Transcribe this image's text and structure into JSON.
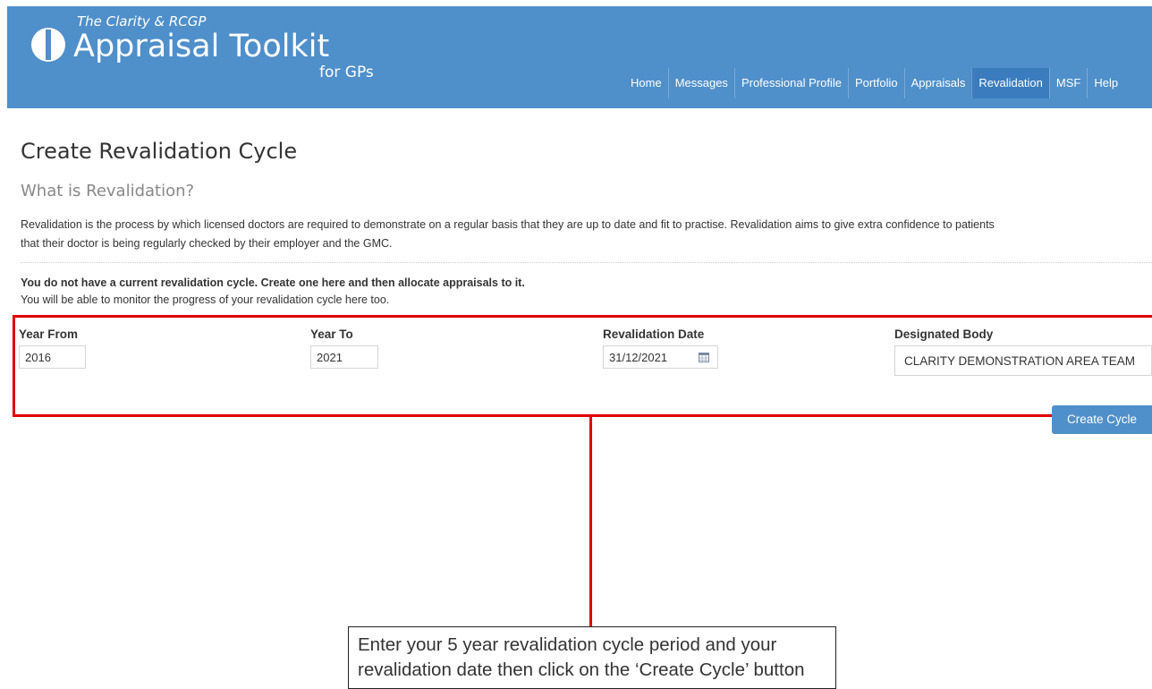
{
  "header": {
    "logo_top": "The Clarity & RCGP",
    "logo_main": "Appraisal Toolkit",
    "logo_sub": "for GPs",
    "nav": [
      {
        "label": "Home",
        "active": false
      },
      {
        "label": "Messages",
        "active": false
      },
      {
        "label": "Professional Profile",
        "active": false
      },
      {
        "label": "Portfolio",
        "active": false
      },
      {
        "label": "Appraisals",
        "active": false
      },
      {
        "label": "Revalidation",
        "active": true
      },
      {
        "label": "MSF",
        "active": false
      },
      {
        "label": "Help",
        "active": false
      }
    ],
    "colors": {
      "bar": "#4f8fca",
      "active": "#3a7cbe"
    }
  },
  "page": {
    "title": "Create Revalidation Cycle",
    "section_title": "What is Revalidation?",
    "intro_line1": "Revalidation is the process by which licensed doctors are required to demonstrate on a regular basis that they are up to date and fit to practise. Revalidation aims to give extra confidence to patients",
    "intro_line2": "that their doctor is being regularly checked by their employer and the GMC.",
    "notice_bold": "You do not have a current revalidation cycle. Create one here and then allocate appraisals to it.",
    "notice": "You will be able to monitor the progress of your revalidation cycle here too."
  },
  "form": {
    "year_from_label": "Year From",
    "year_from_value": "2016",
    "year_to_label": "Year To",
    "year_to_value": "2021",
    "reval_date_label": "Revalidation Date",
    "reval_date_value": "31/12/2021",
    "designated_body_label": "Designated Body",
    "designated_body_value": "CLARITY DEMONSTRATION AREA TEAM",
    "create_button": "Create Cycle"
  },
  "annotation": {
    "callout_text": "Enter your 5 year revalidation cycle period and your revalidation date then click on the ‘Create Cycle’ button",
    "highlight_color": "#e00000"
  }
}
